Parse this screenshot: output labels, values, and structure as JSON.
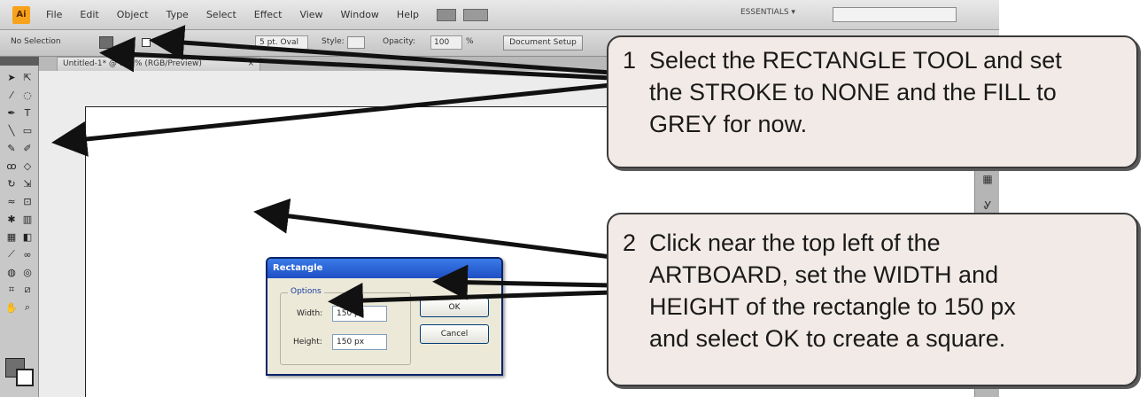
{
  "menubar": {
    "logo": "Ai",
    "items": [
      "File",
      "Edit",
      "Object",
      "Type",
      "Select",
      "Effect",
      "View",
      "Window",
      "Help"
    ],
    "workspace": "ESSENTIALS ▾"
  },
  "controlbar": {
    "selection": "No Selection",
    "brush": "5 pt. Oval",
    "style_label": "Style:",
    "opacity_label": "Opacity:",
    "opacity_value": "100",
    "opacity_unit": "%",
    "doc_setup": "Document Setup"
  },
  "document_tab": {
    "title": "Untitled-1* @ 157% (RGB/Preview)",
    "close": "×"
  },
  "dialog": {
    "title": "Rectangle",
    "options_label": "Options",
    "width_label": "Width:",
    "width_value": "150 px",
    "height_label": "Height:",
    "height_value": "150 px",
    "ok_label": "OK",
    "cancel_label": "Cancel"
  },
  "callouts": {
    "one": {
      "num": "1",
      "lines": [
        "Select the RECTANGLE TOOL and set",
        "the STROKE to NONE and the FILL to",
        "GREY for now."
      ]
    },
    "two": {
      "num": "2",
      "lines": [
        "Click near the top left of the",
        "ARTBOARD, set the WIDTH and",
        "HEIGHT of the rectangle to 150 px",
        "and select OK to create a square."
      ]
    }
  },
  "colors": {
    "callout_bg": "#f2eae6",
    "dialog_title": "#1f4fc4",
    "logo": "#f7a21b"
  }
}
